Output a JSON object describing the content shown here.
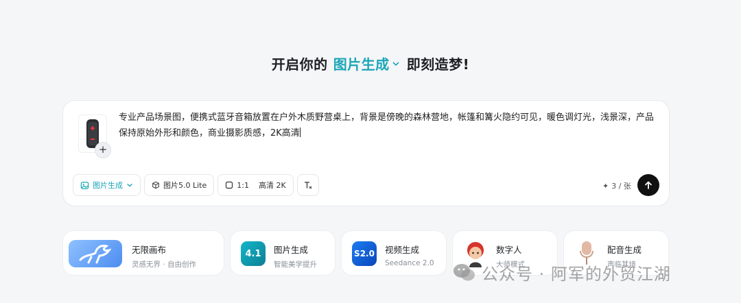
{
  "headline": {
    "prefix": "开启你的",
    "mode": "图片生成",
    "suffix": "即刻造梦!"
  },
  "composer": {
    "prompt": "专业产品场景图，便携式蓝牙音箱放置在户外木质野营桌上，背景是傍晚的森林营地，帐篷和篝火隐约可见，暖色调灯光，浅景深，产品保持原始外形和颜色，商业摄影质感，2K高清",
    "add_label": "+",
    "toolbar": {
      "mode": "图片生成",
      "model": "图片5.0 Lite",
      "ratio": "1:1",
      "quality": "高清 2K"
    },
    "credits": "3 / 张"
  },
  "cards": [
    {
      "title": "无限画布",
      "subtitle": "灵感无界 · 自由创作"
    },
    {
      "title": "图片生成",
      "subtitle": "智能美学提升",
      "badge": "4.1"
    },
    {
      "title": "视频生成",
      "subtitle": "Seedance 2.0",
      "badge": "S2.0"
    },
    {
      "title": "数字人",
      "subtitle": "大师模式"
    },
    {
      "title": "配音生成",
      "subtitle": "声临其境"
    }
  ],
  "watermark": {
    "text": "公众号 · 阿军的外贸江湖"
  },
  "colors": {
    "accent": "#1aa6b7",
    "send": "#111111",
    "background": "#f5f6f8"
  }
}
